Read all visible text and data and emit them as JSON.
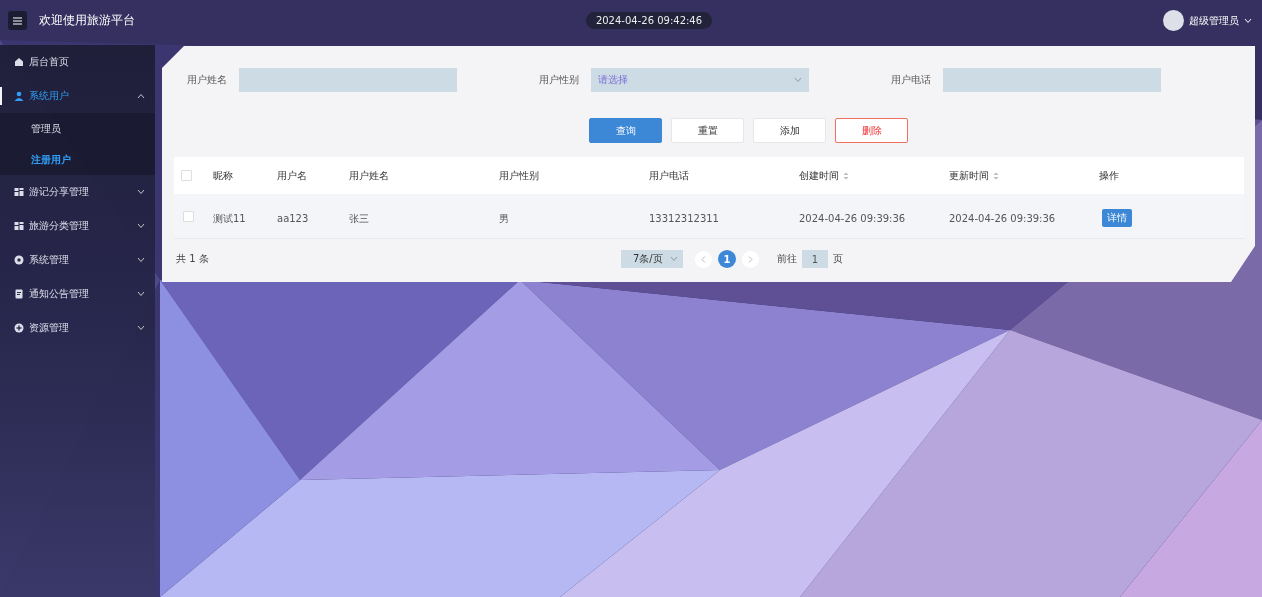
{
  "header": {
    "title": "欢迎使用旅游平台",
    "datetime": "2024-04-26 09:42:46",
    "user": "超级管理员"
  },
  "sidebar": {
    "items": [
      {
        "label": "后台首页",
        "kind": "link",
        "selected": false
      },
      {
        "label": "系统用户",
        "kind": "submenu",
        "selected": true,
        "expanded": true,
        "children": [
          {
            "label": "管理员",
            "selected": false
          },
          {
            "label": "注册用户",
            "selected": true
          }
        ]
      },
      {
        "label": "游记分享管理",
        "kind": "submenu",
        "selected": false,
        "expanded": false
      },
      {
        "label": "旅游分类管理",
        "kind": "submenu",
        "selected": false,
        "expanded": false
      },
      {
        "label": "系统管理",
        "kind": "submenu",
        "selected": false,
        "expanded": false
      },
      {
        "label": "通知公告管理",
        "kind": "submenu",
        "selected": false,
        "expanded": false
      },
      {
        "label": "资源管理",
        "kind": "submenu",
        "selected": false,
        "expanded": false
      }
    ]
  },
  "search_form": {
    "fields": [
      {
        "label": "用户姓名",
        "kind": "text"
      },
      {
        "label": "用户性别",
        "kind": "select",
        "placeholder": "请选择"
      },
      {
        "label": "用户电话",
        "kind": "text"
      }
    ],
    "buttons": [
      {
        "label": "查询",
        "kind": "primary"
      },
      {
        "label": "重置",
        "kind": "default"
      },
      {
        "label": "添加",
        "kind": "default"
      },
      {
        "label": "删除",
        "kind": "danger"
      }
    ]
  },
  "table": {
    "all_checked": false,
    "columns": [
      {
        "label": "昵称",
        "sortable": false
      },
      {
        "label": "用户名",
        "sortable": false
      },
      {
        "label": "用户姓名",
        "sortable": false
      },
      {
        "label": "用户性别",
        "sortable": false
      },
      {
        "label": "用户电话",
        "sortable": false
      },
      {
        "label": "创建时间",
        "sortable": true
      },
      {
        "label": "更新时间",
        "sortable": true
      },
      {
        "label": "操作",
        "sortable": false
      }
    ],
    "rows": [
      {
        "checked": false,
        "cells": [
          "测试11",
          "aa123",
          "张三",
          "男",
          "13312312311",
          "2024-04-26 09:39:36",
          "2024-04-26 09:39:36"
        ],
        "action": "详情"
      }
    ]
  },
  "pagination": {
    "total": "共 1 条",
    "page_size": "7条/页",
    "pages": [
      {
        "label": "1",
        "selected": true
      }
    ],
    "goto_label": "前往",
    "goto_value": "1",
    "goto_suffix": "页"
  }
}
